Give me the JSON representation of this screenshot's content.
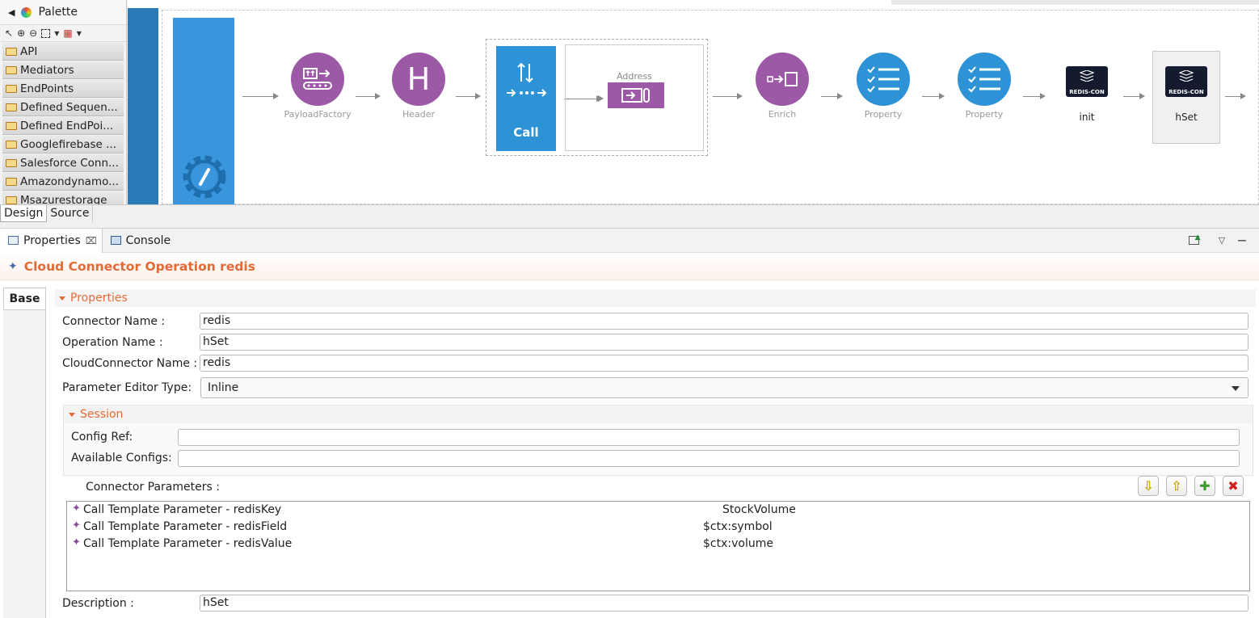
{
  "palette": {
    "title": "Palette",
    "drawers": [
      "API",
      "Mediators",
      "EndPoints",
      "Defined Sequen...",
      "Defined EndPoi...",
      "Googlefirebase ...",
      "Salesforce Conn...",
      "Amazondynamo...",
      "Msazurestorage"
    ]
  },
  "canvas": {
    "nodes": {
      "payload_factory": "PayloadFactory",
      "header": "Header",
      "header_glyph": "H",
      "call": "Call",
      "address": "Address",
      "enrich": "Enrich",
      "property1": "Property",
      "property2": "Property",
      "redis_init": "init",
      "redis_hset": "hSet",
      "redis_chip_label": "REDIS-CON"
    }
  },
  "editor_tabs": {
    "design": "Design",
    "source": "Source"
  },
  "views": {
    "properties_tab": "Properties",
    "console_tab": "Console"
  },
  "properties": {
    "title": "Cloud Connector Operation redis",
    "base_tab": "Base",
    "section": "Properties",
    "connector_name_label": "Connector Name :",
    "connector_name": "redis",
    "operation_name_label": "Operation Name :",
    "operation_name": "hSet",
    "cloud_connector_name_label": "CloudConnector Name :",
    "cloud_connector_name": "redis",
    "param_editor_type_label": "Parameter Editor Type:",
    "param_editor_type": "Inline",
    "session": {
      "title": "Session",
      "config_ref_label": "Config Ref:",
      "config_ref": "",
      "available_configs_label": "Available Configs:",
      "available_configs": ""
    },
    "connector_params_label": "Connector Parameters :",
    "params": [
      {
        "name": "Call Template Parameter  - redisKey",
        "value": "StockVolume"
      },
      {
        "name": "Call Template Parameter  - redisField",
        "value": "$ctx:symbol"
      },
      {
        "name": "Call Template Parameter  - redisValue",
        "value": "$ctx:volume"
      }
    ],
    "description_label": "Description :",
    "description": "hSet"
  },
  "colors": {
    "accent": "#e46a35",
    "mediator_purple": "#9b59a6",
    "mediator_blue": "#2e93d6"
  }
}
